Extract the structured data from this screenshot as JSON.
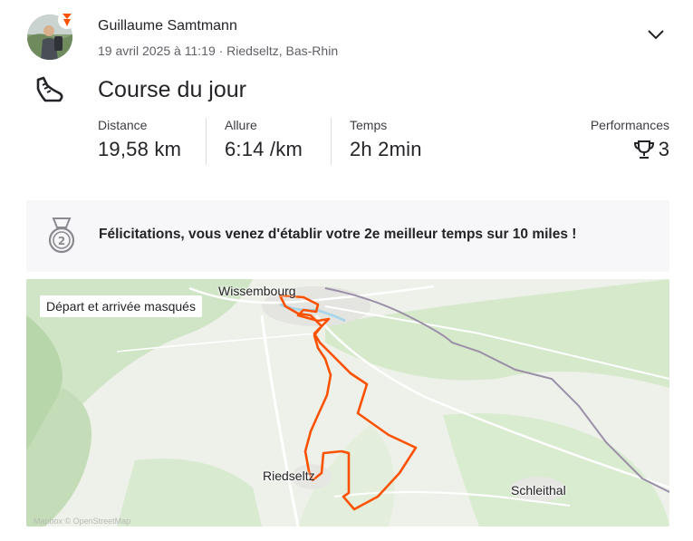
{
  "athlete": {
    "name": "Guillaume Samtmann",
    "avatar": "athlete-photo"
  },
  "activity": {
    "meta": "19 avril 2025 à 11:19 · Riedseltz, Bas-Rhin",
    "title": "Course du jour",
    "sport_icon": "running-shoe-icon"
  },
  "stats": [
    {
      "label": "Distance",
      "value": "19,58 km"
    },
    {
      "label": "Allure",
      "value": "6:14 /km"
    },
    {
      "label": "Temps",
      "value": "2h 2min"
    }
  ],
  "performances": {
    "label": "Performances",
    "count": "3",
    "icon": "trophy-icon"
  },
  "achievement": {
    "text": "Félicitations, vous venez d'établir votre 2e meilleur temps sur 10 miles !",
    "icon": "medal-2-icon"
  },
  "map": {
    "privacy_label": "Départ et arrivée masqués",
    "places": [
      "Wissembourg",
      "Riedseltz",
      "Schleithal"
    ],
    "credit": "Mapbox © OpenStreetMap",
    "route_color": "#fc5200"
  },
  "colors": {
    "accent": "#fc5200",
    "text": "#242428",
    "muted": "#5f5f66"
  }
}
